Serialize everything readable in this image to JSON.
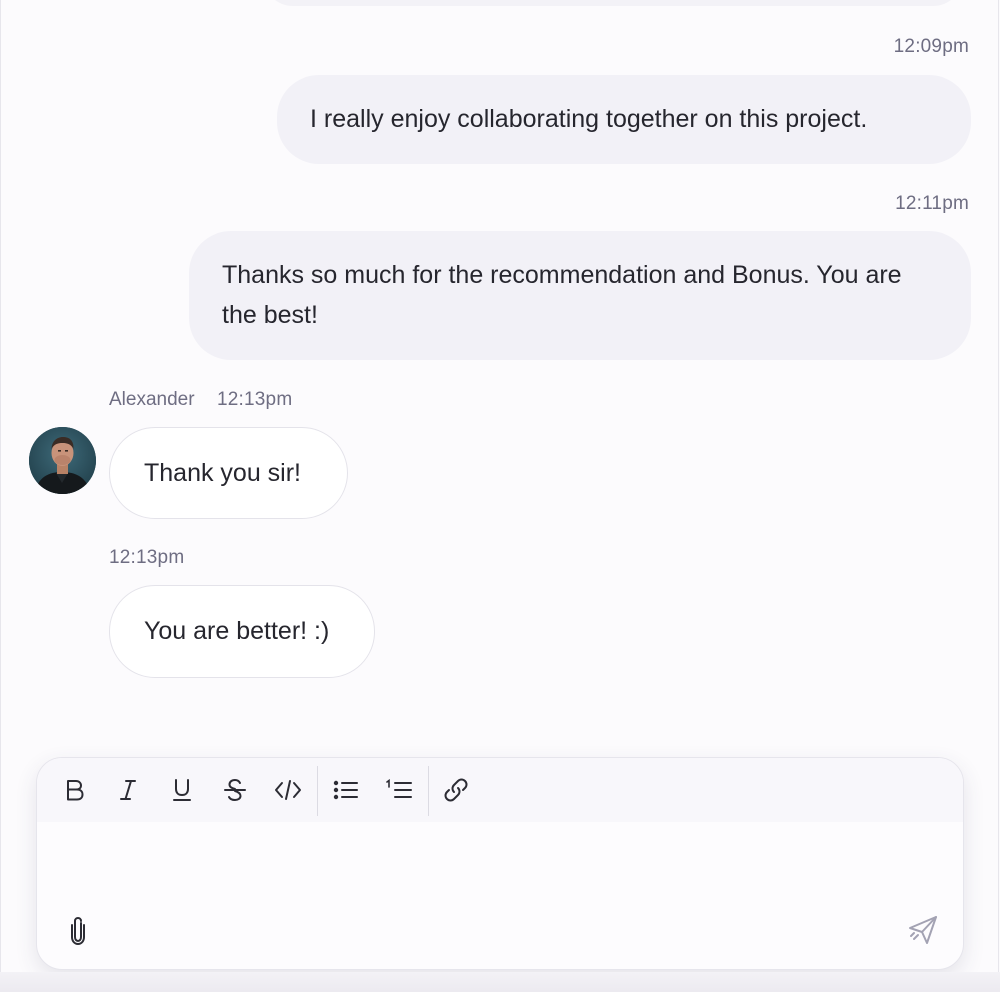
{
  "messages": [
    {
      "direction": "outgoing",
      "time": "12:09pm",
      "text": "I really enjoy collaborating together on this project."
    },
    {
      "direction": "outgoing",
      "time": "12:11pm",
      "text": "Thanks so much for the recommendation and Bonus. You are the best!"
    },
    {
      "direction": "incoming",
      "sender": "Alexander",
      "time": "12:13pm",
      "text": "Thank you sir!"
    },
    {
      "direction": "incoming",
      "time": "12:13pm",
      "text": "You are better! :)"
    }
  ],
  "composer": {
    "value": "",
    "toolbar": [
      {
        "icon": "bold-icon"
      },
      {
        "icon": "italic-icon"
      },
      {
        "icon": "underline-icon"
      },
      {
        "icon": "strikethrough-icon"
      },
      {
        "icon": "code-icon"
      },
      {
        "icon": "bullet-list-icon"
      },
      {
        "icon": "numbered-list-icon"
      },
      {
        "icon": "link-icon"
      }
    ],
    "attach_icon": "paperclip-icon",
    "send_icon": "send-icon"
  },
  "colors": {
    "outgoing_bubble": "#f2f1f7",
    "incoming_bubble": "#ffffff",
    "timestamp": "#6e6d82",
    "text": "#26262e"
  }
}
